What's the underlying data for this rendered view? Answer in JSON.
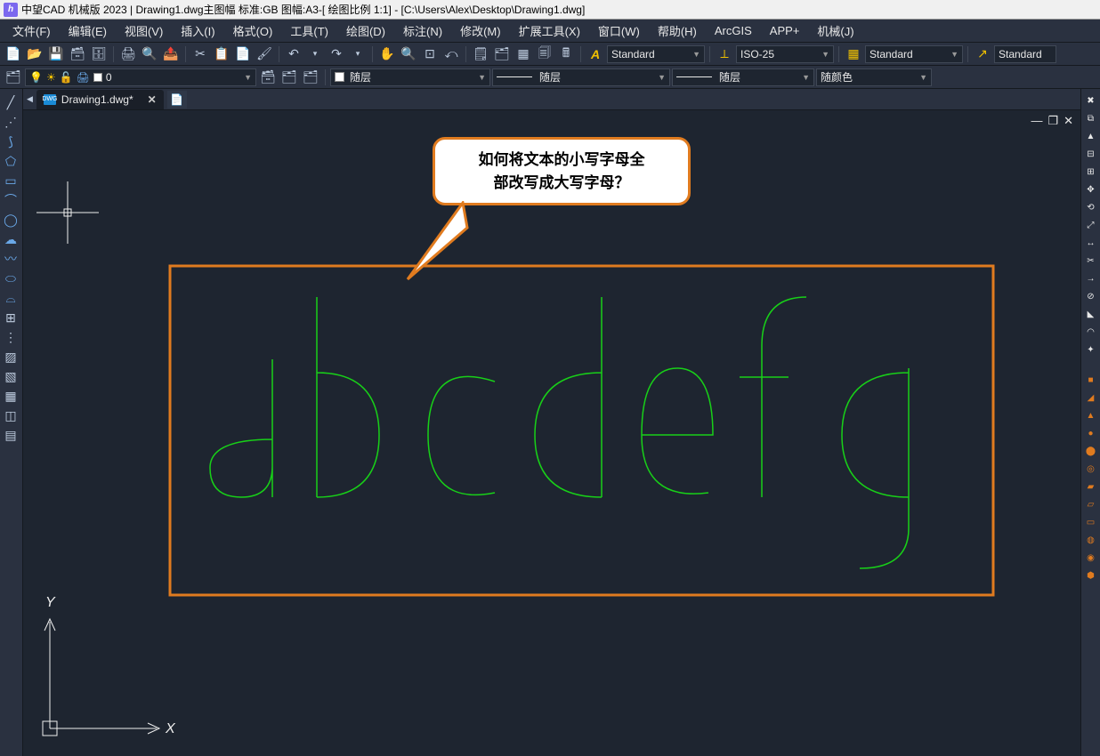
{
  "title": "中望CAD 机械版 2023 | Drawing1.dwg主图幅  标准:GB 图幅:A3-[ 绘图比例 1:1] - [C:\\Users\\Alex\\Desktop\\Drawing1.dwg]",
  "app_icon_text": "h",
  "menu": {
    "file": "文件(F)",
    "edit": "编辑(E)",
    "view": "视图(V)",
    "insert": "插入(I)",
    "format": "格式(O)",
    "tools": "工具(T)",
    "draw": "绘图(D)",
    "annotate": "标注(N)",
    "modify": "修改(M)",
    "extend": "扩展工具(X)",
    "window": "窗口(W)",
    "help": "帮助(H)",
    "arcgis": "ArcGIS",
    "appplus": "APP+",
    "mech": "机械(J)"
  },
  "style_panel": {
    "text_style_label": "A",
    "text_style_value": "Standard",
    "dim_style_value": "ISO-25",
    "table_style_value": "Standard",
    "mleader_style_value": "Standard"
  },
  "layer_panel": {
    "layer_value": "0",
    "bylayer1": "随层",
    "bylayer2": "随层",
    "bylayer3": "随层",
    "bycolor": "随颜色"
  },
  "tab": {
    "name": "Drawing1.dwg*",
    "dwg_badge": "DWG"
  },
  "callout": {
    "line1": "如何将文本的小写字母全",
    "line2": "部改写成大写字母？"
  },
  "drawing": {
    "text": "abcdefg",
    "axis_y": "Y",
    "axis_x": "X"
  },
  "left_tool_names": [
    "line-tool",
    "construction-line-tool",
    "arc-tool",
    "polygon-tool",
    "rectangle-tool",
    "arc2-tool",
    "circle-tool",
    "revision-cloud-tool",
    "spline-tool",
    "ellipse-tool",
    "ellipse-arc-tool",
    "block-tool",
    "point-tool",
    "hatch-tool",
    "region-tool",
    "table-tool",
    "gradient-tool",
    "boundary-tool"
  ],
  "right_tool_names": [
    "erase-tool",
    "copy-tool",
    "mirror-tool",
    "offset-tool",
    "array-tool",
    "move-tool",
    "rotate-tool",
    "scale-tool",
    "stretch-tool",
    "trim-tool",
    "extend-tool",
    "break-tool",
    "chamfer-tool",
    "fillet-tool",
    "explode-tool",
    "separator",
    "box-tool",
    "wedge-tool",
    "cone-tool",
    "sphere-tool",
    "cylinder-tool",
    "torus-tool",
    "pyramid-tool",
    "extra1-tool",
    "extra2-tool",
    "extra3-tool",
    "extra4-tool",
    "extra5-tool"
  ]
}
